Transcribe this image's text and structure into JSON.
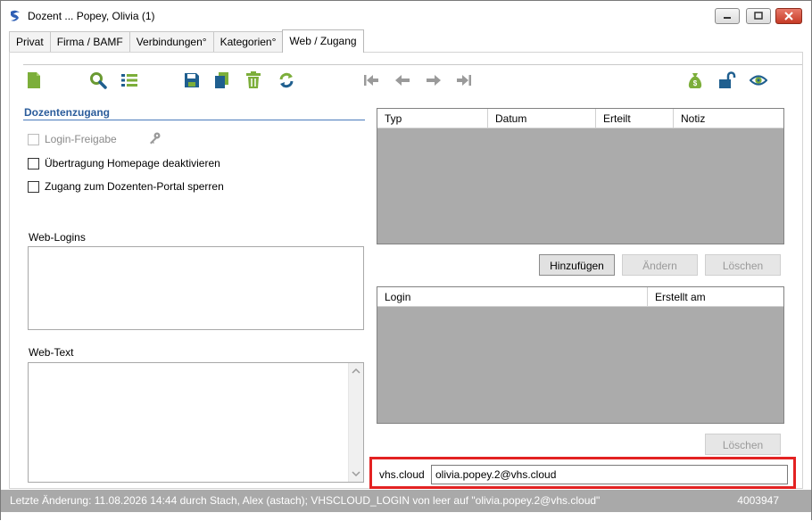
{
  "window": {
    "title": "Dozent ... Popey, Olivia (1)",
    "controls": {
      "minimize": "minimize-icon",
      "maximize": "maximize-icon",
      "close": "close-icon"
    }
  },
  "tabs": [
    {
      "label": "Privat"
    },
    {
      "label": "Firma / BAMF"
    },
    {
      "label": "Verbindungen°"
    },
    {
      "label": "Kategorien°"
    },
    {
      "label": "Web / Zugang",
      "active": true
    }
  ],
  "toolbar": {
    "icons": [
      "new-document-icon",
      "search-icon",
      "list-icon",
      "save-icon",
      "copy-icon",
      "delete-icon",
      "refresh-icon",
      "first-record-icon",
      "previous-record-icon",
      "next-record-icon",
      "last-record-icon",
      "money-bag-icon",
      "unlock-icon",
      "eye-icon"
    ]
  },
  "section": {
    "title": "Dozentenzugang"
  },
  "checkboxes": {
    "login_freigabe": "Login-Freigabe",
    "homepage": "Übertragung Homepage deaktivieren",
    "portal": "Zugang zum Dozenten-Portal sperren"
  },
  "web_logins": {
    "label": "Web-Logins"
  },
  "web_text": {
    "label": "Web-Text"
  },
  "grid_top": {
    "columns": [
      "Typ",
      "Datum",
      "Erteilt",
      "Notiz"
    ]
  },
  "grid_top_buttons": {
    "add": "Hinzufügen",
    "edit": "Ändern",
    "delete": "Löschen"
  },
  "grid_bottom": {
    "columns": [
      "Login",
      "Erstellt am"
    ]
  },
  "grid_bottom_buttons": {
    "delete": "Löschen"
  },
  "vhscloud": {
    "label": "vhs.cloud",
    "value": "olivia.popey.2@vhs.cloud"
  },
  "status": {
    "text": "Letzte Änderung: 11.08.2026 14:44 durch Stach, Alex (astach); VHSCLOUD_LOGIN von leer auf \"olivia.popey.2@vhs.cloud\"",
    "id": "4003947"
  },
  "colors": {
    "accent": "#2b5c9b",
    "grid_body": "#ababab",
    "status_bar": "#a9a9a9",
    "highlight": "#e32222",
    "icon_green": "#7cae3a",
    "icon_blue": "#1f5f8f"
  }
}
